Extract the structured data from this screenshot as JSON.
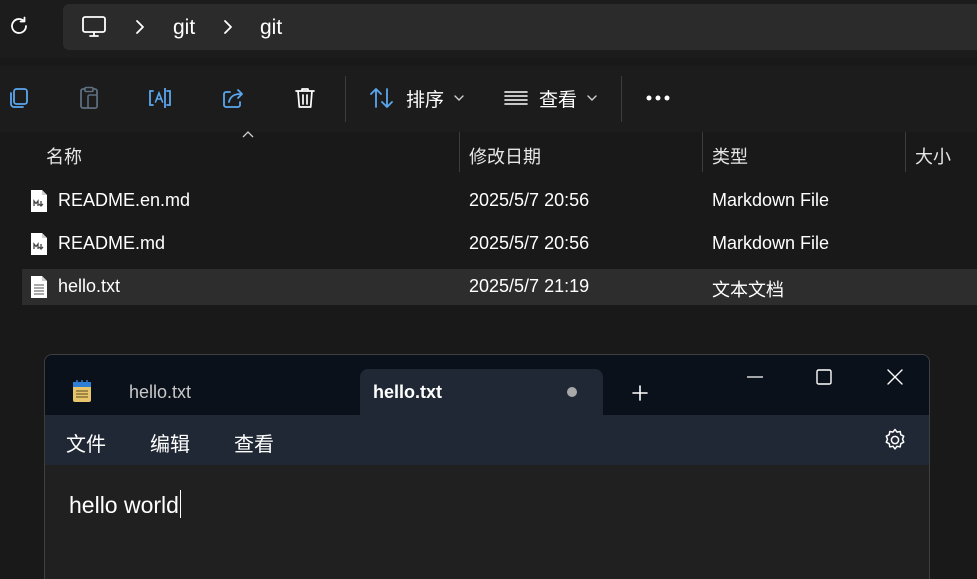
{
  "address_bar": {
    "breadcrumbs": [
      "git",
      "git"
    ],
    "icons": {
      "refresh": "refresh-icon",
      "computer": "computer-icon",
      "separator": "chevron-right-icon"
    }
  },
  "toolbar": {
    "sort_label": "排序",
    "view_label": "查看",
    "icons": [
      "copy-icon",
      "paste-icon",
      "rename-icon",
      "share-icon",
      "delete-icon",
      "sort-icon",
      "view-list-icon",
      "more-icon"
    ]
  },
  "file_list": {
    "columns": [
      "名称",
      "修改日期",
      "类型",
      "大小"
    ],
    "sorted_column": "名称",
    "rows": [
      {
        "name": "README.en.md",
        "modified": "2025/5/7 20:56",
        "type": "Markdown File",
        "icon": "markdown-file-icon",
        "selected": false
      },
      {
        "name": "README.md",
        "modified": "2025/5/7 20:56",
        "type": "Markdown File",
        "icon": "markdown-file-icon",
        "selected": false
      },
      {
        "name": "hello.txt",
        "modified": "2025/5/7 21:19",
        "type": "文本文档",
        "icon": "text-file-icon",
        "selected": true
      }
    ]
  },
  "notepad": {
    "tabs": [
      {
        "label": "hello.txt",
        "active": false
      },
      {
        "label": "hello.txt",
        "active": true,
        "unsaved": true
      }
    ],
    "menu": [
      "文件",
      "编辑",
      "查看"
    ],
    "content": "hello world",
    "icons": {
      "app": "notepad-icon",
      "new_tab": "plus-icon",
      "settings": "gear-icon",
      "minimize": "minimize-icon",
      "maximize": "maximize-icon",
      "close": "close-icon"
    }
  },
  "colors": {
    "background": "#191919",
    "selected_row": "#2d2d2d",
    "notepad_titlebar": "#0b111a",
    "notepad_tab_active": "#1f2834",
    "notepad_editor": "#202020"
  }
}
